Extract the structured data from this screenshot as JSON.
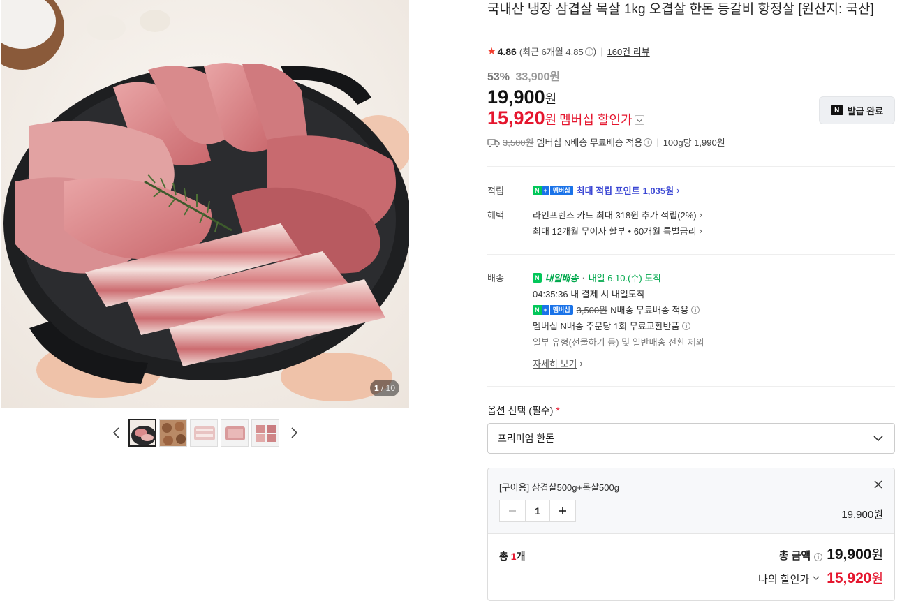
{
  "gallery": {
    "counter_current": "1",
    "counter_total": "10",
    "thumbnail_count": 5
  },
  "product": {
    "title": "국내산 냉장 삼겹살 목살 1kg 오겹살 한돈 등갈비 항정살 [원산지: 국산]",
    "rating": "4.86",
    "rating_recent": "(최근 6개월 4.85",
    "rating_recent_close": ")",
    "review_link": "160건 리뷰",
    "discount_rate": "53%",
    "original_price": "33,900원",
    "sale_price": "19,900",
    "currency": "원",
    "member_price": "15,920",
    "member_label": "멤버십 할인가",
    "coupon_button": "발급 완료"
  },
  "shipping_summary": {
    "orig_fee": "3,500원",
    "text": "멤버십 N배송 무료배송 적용",
    "unit_price": "100g당 1,990원"
  },
  "benefits": {
    "points_label": "적립",
    "points_badge": "멤버십",
    "points_text": "최대 적립 포인트",
    "points_value": "1,035원",
    "benefit_label": "혜택",
    "card_benefit": "라인프렌즈 카드 최대 318원 추가 적립(2%)",
    "installment": "최대 12개월 무이자 할부 • 60개월 특별금리"
  },
  "delivery": {
    "label": "배송",
    "tomorrow_badge": "내일배송",
    "arrival": "내일 6.10.(수) 도착",
    "cutoff": "04:35:36  내 결제 시 내일도착",
    "member_badge": "멤버십",
    "orig_fee": "3,500원",
    "free_text": "N배송 무료배송 적용",
    "exchange": "멤버십 N배송 주문당 1회 무료교환반품",
    "exclusion": "일부 유형(선물하기 등) 및 일반배송 전환 제외",
    "more_link": "자세히 보기"
  },
  "options": {
    "label": "옵션 선택 (필수)",
    "required_mark": "*",
    "selected": "프리미엄 한돈",
    "item_name": "[구이용] 삼겹살500g+목살500g",
    "quantity": "1",
    "item_price": "19,900원",
    "total_count_prefix": "총 ",
    "total_count": "1",
    "total_count_suffix": "개",
    "total_label": "총 금액",
    "total_value": "19,900",
    "my_discount_label": "나의 할인가",
    "my_discount_value": "15,920",
    "won": "원"
  },
  "colors": {
    "accent_red": "#e5162e",
    "membership_blue": "#3c48d4",
    "naver_green": "#03c75a"
  }
}
